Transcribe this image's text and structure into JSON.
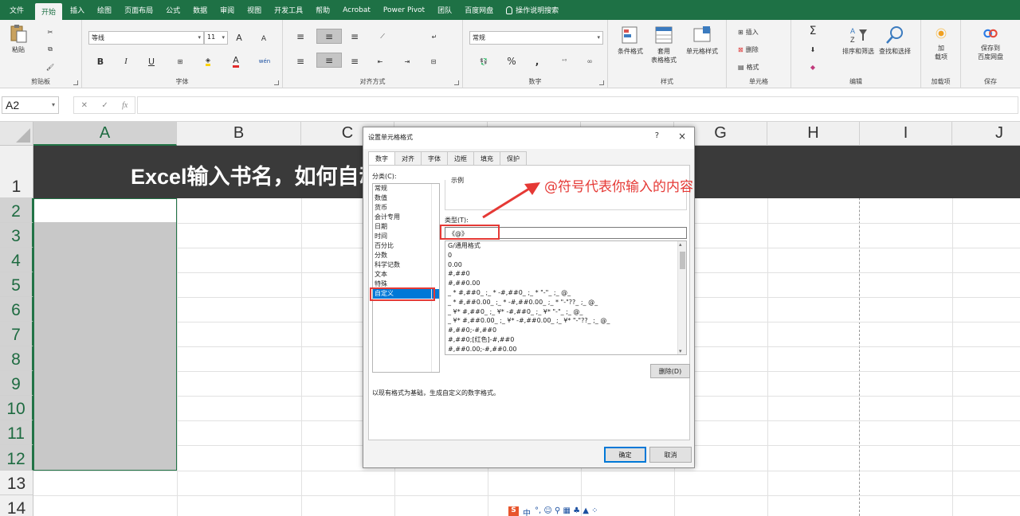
{
  "menu": {
    "tabs": [
      "文件",
      "开始",
      "插入",
      "绘图",
      "页面布局",
      "公式",
      "数据",
      "审阅",
      "视图",
      "开发工具",
      "帮助",
      "Acrobat",
      "Power Pivot",
      "团队",
      "百度网盘"
    ],
    "active_tab": "开始",
    "tell_me": "操作说明搜索"
  },
  "ribbon": {
    "clipboard": {
      "paste": "粘贴",
      "label": "剪贴板"
    },
    "font": {
      "name": "等线",
      "size": "11",
      "bold": "B",
      "italic": "I",
      "underline": "U",
      "label": "字体",
      "grow": "A",
      "shrink": "A",
      "color_letter": "A",
      "wen": "wén"
    },
    "alignment": {
      "label": "对齐方式"
    },
    "number": {
      "format": "常规",
      "percent": "%",
      "comma": ",",
      "label": "数字"
    },
    "styles": {
      "conditional": "条件格式",
      "table": "套用\n表格格式",
      "cell": "单元格样式",
      "label": "样式"
    },
    "cells": {
      "insert": "插入",
      "delete": "删除",
      "format": "格式",
      "label": "单元格"
    },
    "editing": {
      "sort": "排序和筛选",
      "find": "查找和选择",
      "label": "编辑"
    },
    "addins": {
      "load": "加\n载项",
      "label": "加载项"
    },
    "save": {
      "save_to": "保存到\n百度网盘",
      "label": "保存"
    }
  },
  "formula_bar": {
    "name_box": "A2",
    "fx": "fx",
    "formula": ""
  },
  "grid": {
    "columns": [
      "A",
      "B",
      "C",
      "D",
      "E",
      "F",
      "G",
      "H",
      "I",
      "J"
    ],
    "rows": [
      "1",
      "2",
      "3",
      "4",
      "5",
      "6",
      "7",
      "8",
      "9",
      "10",
      "11",
      "12",
      "13",
      "14"
    ],
    "banner_text": "Excel输入书名，如何自动添加书名号"
  },
  "dialog": {
    "title": "设置单元格格式",
    "help": "?",
    "close": "×",
    "tabs": [
      "数字",
      "对齐",
      "字体",
      "边框",
      "填充",
      "保护"
    ],
    "active_tab": "数字",
    "category_label": "分类(C):",
    "categories": [
      "常规",
      "数值",
      "货币",
      "会计专用",
      "日期",
      "时间",
      "百分比",
      "分数",
      "科学记数",
      "文本",
      "特殊",
      "自定义"
    ],
    "selected_category": "自定义",
    "sample_label": "示例",
    "type_label": "类型(T):",
    "type_value": "《@》",
    "formats": [
      "G/通用格式",
      "0",
      "0.00",
      "#,##0",
      "#,##0.00",
      "_ * #,##0_ ;_ * -#,##0_ ;_ * \"-\"_ ;_ @_",
      "_ * #,##0.00_ ;_ * -#,##0.00_ ;_ * \"-\"??_ ;_ @_",
      "_ ¥* #,##0_ ;_ ¥* -#,##0_ ;_ ¥* \"-\"_ ;_ @_",
      "_ ¥* #,##0.00_ ;_ ¥* -#,##0.00_ ;_ ¥* \"-\"??_ ;_ @_",
      "#,##0;-#,##0",
      "#,##0;[红色]-#,##0",
      "#,##0.00;-#,##0.00"
    ],
    "delete_button": "删除(D)",
    "description": "以现有格式为基础，生成自定义的数字格式。",
    "ok": "确定",
    "cancel": "取消"
  },
  "annotation": "@符号代表你输入的内容",
  "ime": {
    "s": "S",
    "lang": "中",
    "symbols": "°, ☺ ⚲ ▦ ♣ ▲ ⁘"
  },
  "colors": {
    "excel_green": "#1e7145",
    "annotation_red": "#e53935",
    "banner_bg": "#3a3a3a",
    "selection_blue": "#0078d7"
  }
}
